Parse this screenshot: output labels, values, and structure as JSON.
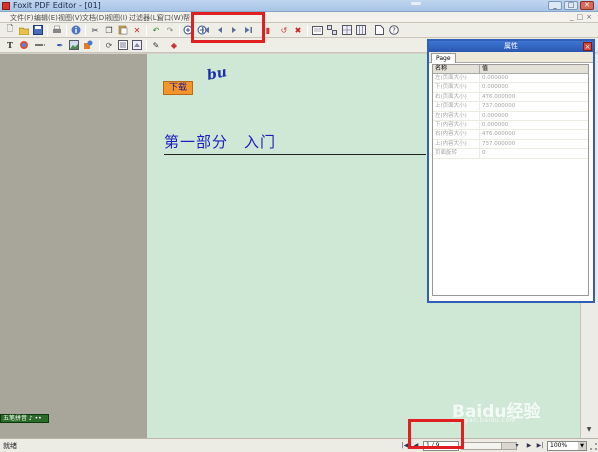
{
  "window": {
    "title": "Foxit PDF Editor - [01]",
    "controls": {
      "minimize": "_",
      "maximize": "□",
      "close": "✕"
    }
  },
  "menu": {
    "items": [
      "文件(F)",
      "编辑(E)",
      "视图(V)",
      "文档(D)",
      "视图(I)",
      "过滤器(L)",
      "窗口(W)",
      "帮"
    ],
    "mdi_controls": [
      "_",
      "□",
      "×"
    ]
  },
  "toolbar_row1": {
    "icons": [
      "new-icon",
      "open-icon",
      "save-icon",
      "print-icon",
      "info-icon",
      "cut-icon",
      "copy-icon",
      "paste-icon",
      "delete-icon",
      "undo-icon",
      "redo-icon",
      "zoom-in-icon",
      "zoom-out-icon",
      "first-page-icon",
      "prev-page-icon",
      "next-page-icon",
      "last-page-icon",
      "insert-page-icon",
      "rotate-icon",
      "delete-page-icon",
      "page-view-icon",
      "thumbnails-icon",
      "grid-icon",
      "layout-icon",
      "extract-icon",
      "help-icon"
    ]
  },
  "toolbar_row2": {
    "icons": [
      "text-tool-icon",
      "color-icon",
      "line-icon",
      "pen-icon",
      "image-icon",
      "shape-icon",
      "crop-icon",
      "resize-icon",
      "edit-icon",
      "fill-icon"
    ]
  },
  "left_panel": {
    "ime_label": "五笔拼音 ♪ ••"
  },
  "document": {
    "download_button": "下载",
    "handwriting": "bu",
    "heading": "第一部分　入门"
  },
  "properties_panel": {
    "title": "属性",
    "tab": "Page",
    "col_name": "名称",
    "col_value": "值",
    "rows": [
      {
        "name": "左(页面大小)",
        "value": "0.000000"
      },
      {
        "name": "下(页面大小)",
        "value": "0.000000"
      },
      {
        "name": "右(页面大小)",
        "value": "476.000000"
      },
      {
        "name": "上(页面大小)",
        "value": "737.000000"
      },
      {
        "name": "左(内容大小)",
        "value": "0.000000"
      },
      {
        "name": "下(内容大小)",
        "value": "0.000000"
      },
      {
        "name": "右(内容大小)",
        "value": "476.000000"
      },
      {
        "name": "上(内容大小)",
        "value": "737.000000"
      },
      {
        "name": "页面旋转",
        "value": "0"
      }
    ]
  },
  "statusbar": {
    "status": "就绪",
    "page_indicator": "1 / 9",
    "zoom": "100%"
  },
  "watermark": {
    "brand": "Baidu经验",
    "url": "jingyan.baidu.com"
  },
  "colors": {
    "page_background": "#cfe8d6",
    "gray_area": "#a8a59a",
    "highlight": "#e02020",
    "heading": "#1c1cbf",
    "download_button": "#f3952b",
    "panel_title": "#2a58b0"
  }
}
